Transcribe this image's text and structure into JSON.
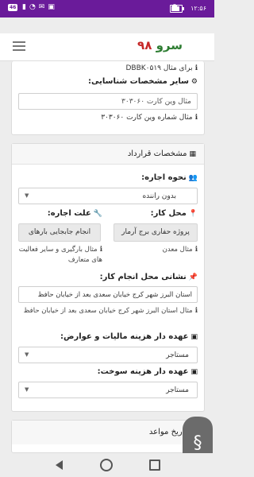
{
  "status_bar": {
    "time": "۱۲:۵۶",
    "sim_label": "46",
    "battery_level": 0.85
  },
  "app_bar": {
    "brand_main": "سرو",
    "brand_num": "۹۸"
  },
  "identity": {
    "example_text": "برای مثال DBBK۰۵۱۹",
    "other_ids_label": "سایر مشخصات شناسایی:",
    "vin_placeholder": "مثال وین کارت ۳۰۳۰۶۰",
    "vin_hint": "مثال شماره وین کارت ۳۰۳۰۶۰"
  },
  "contract": {
    "section_title": "مشخصات قرارداد",
    "rent_type_label": "نحوه اجاره:",
    "rent_type_value": "بدون راننده",
    "location_label": "محل کار:",
    "location_value": "پروژه حفاری برج آرمار",
    "location_hint": "مثال معدن",
    "reason_label": "علت اجاره:",
    "reason_value": "انجام جابجایی بارهای",
    "reason_hint": "مثال بارگیری و سایر فعالیت های متعارف",
    "address_label": "نشانی محل انجام کار:",
    "address_value": "استان البرز شهر کرج خیابان سعدی بعد از خیابان حافظ",
    "address_hint": "مثال استان البرز شهر کرج خیابان سعدی بعد از خیابان حافظ",
    "tax_label": "عهده دار هزینه مالیات و عوارض:",
    "tax_value": "مستاجر",
    "fuel_label": "عهده دار هزینه سوخت:",
    "fuel_value": "مستاجر"
  },
  "dates": {
    "section_title": "تاریخ مواعد"
  },
  "icons": {
    "calendar": "calendar-icon",
    "users": "users-icon",
    "map_marker": "map-marker-icon",
    "wrench": "wrench-icon",
    "pin": "pin-icon",
    "money": "money-icon",
    "cogs": "cogs-icon",
    "info": "info-circle-icon",
    "menu": "hamburger-menu-icon",
    "scroll": "fast-scroll-handle-icon"
  },
  "colors": {
    "status_bar": "#6a1b9a",
    "brand_green": "#2e7d32",
    "brand_red": "#c62828"
  }
}
